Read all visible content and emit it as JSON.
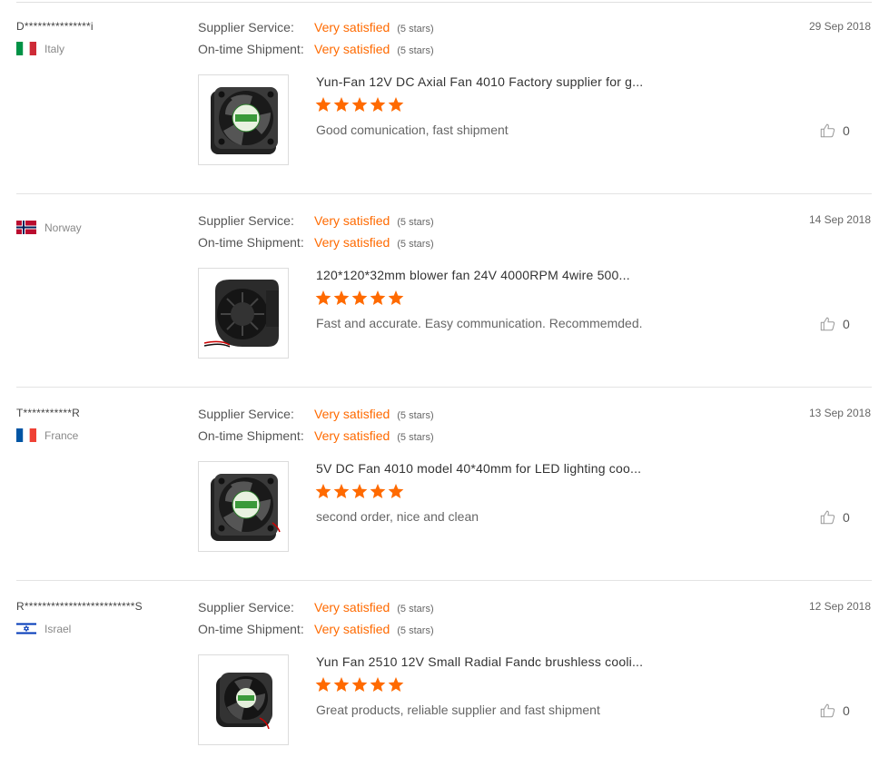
{
  "labels": {
    "supplier_service": "Supplier Service:",
    "ontime_shipment": "On-time Shipment:"
  },
  "colors": {
    "accent": "#ff6a00",
    "star": "#ff6a00",
    "divider": "#e3e3e3"
  },
  "reviews": [
    {
      "buyer": "D***************i",
      "country": "Italy",
      "flag": "italy-flag",
      "date": "29 Sep 2018",
      "supplier_service": "Very satisfied",
      "supplier_service_stars": "(5 stars)",
      "ontime_shipment": "Very satisfied",
      "ontime_shipment_stars": "(5 stars)",
      "product_title": "Yun-Fan 12V DC Axial Fan 4010 Factory supplier for g...",
      "rating": 5,
      "comment": "Good comunication, fast shipment",
      "likes": "0",
      "image": "axial-fan-image"
    },
    {
      "buyer": "",
      "country": "Norway",
      "flag": "norway-flag",
      "date": "14 Sep 2018",
      "supplier_service": "Very satisfied",
      "supplier_service_stars": "(5 stars)",
      "ontime_shipment": "Very satisfied",
      "ontime_shipment_stars": "(5 stars)",
      "product_title": "120*120*32mm blower fan 24V 4000RPM 4wire 500...",
      "rating": 5,
      "comment": "Fast and accurate. Easy communication. Recommemded.",
      "likes": "0",
      "image": "blower-fan-image"
    },
    {
      "buyer": "T***********R",
      "country": "France",
      "flag": "france-flag",
      "date": "13 Sep 2018",
      "supplier_service": "Very satisfied",
      "supplier_service_stars": "(5 stars)",
      "ontime_shipment": "Very satisfied",
      "ontime_shipment_stars": "(5 stars)",
      "product_title": "5V DC Fan 4010 model 40*40mm for LED lighting coo...",
      "rating": 5,
      "comment": "second order, nice and clean",
      "likes": "0",
      "image": "axial-fan-image"
    },
    {
      "buyer": "R*************************S",
      "country": "Israel",
      "flag": "israel-flag",
      "date": "12 Sep 2018",
      "supplier_service": "Very satisfied",
      "supplier_service_stars": "(5 stars)",
      "ontime_shipment": "Very satisfied",
      "ontime_shipment_stars": "(5 stars)",
      "product_title": "Yun Fan 2510 12V Small Radial Fandc brushless cooli...",
      "rating": 5,
      "comment": "Great products,  reliable supplier and fast shipment",
      "likes": "0",
      "image": "small-fan-image"
    }
  ]
}
